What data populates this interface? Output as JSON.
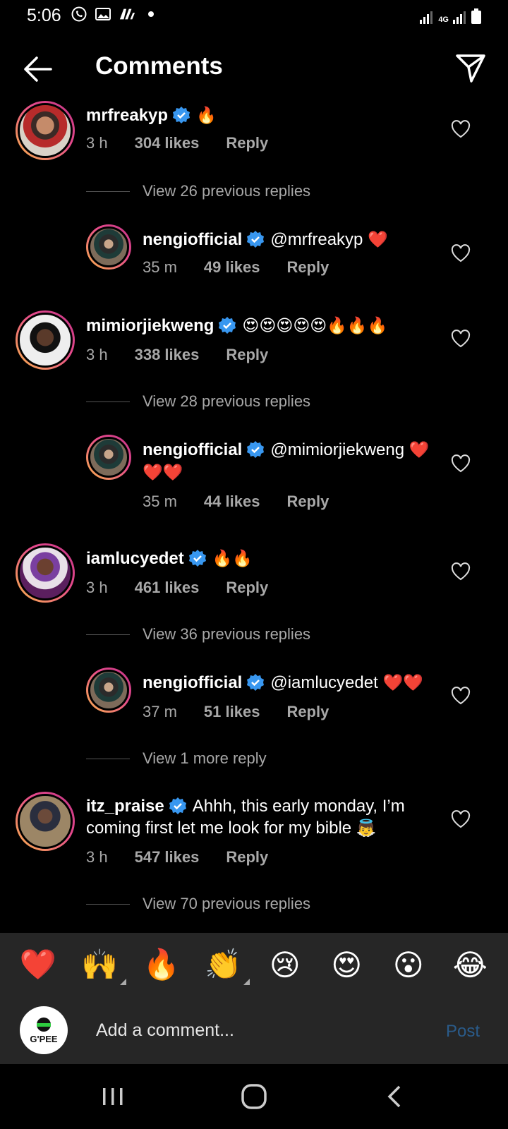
{
  "status_bar": {
    "time": "5:06",
    "network": "4G"
  },
  "header": {
    "title": "Comments"
  },
  "comments": [
    {
      "user": "mrfreakyp",
      "text": "",
      "emoji": "🔥",
      "time": "3 h",
      "likes": "304 likes",
      "reply": "Reply",
      "view_replies": "View 26 previous replies",
      "sub": {
        "user": "nengiofficial",
        "text": "@mrfreakyp",
        "emoji": "❤️",
        "time": "35 m",
        "likes": "49 likes",
        "reply": "Reply"
      }
    },
    {
      "user": "mimiorjiekweng",
      "text": "",
      "emoji": "😍😍😍😍😍🔥🔥🔥",
      "time": "3 h",
      "likes": "338 likes",
      "reply": "Reply",
      "view_replies": "View 28 previous replies",
      "sub": {
        "user": "nengiofficial",
        "text": "@mimiorjiekweng",
        "emoji": "❤️",
        "emoji2": "❤️❤️",
        "time": "35 m",
        "likes": "44 likes",
        "reply": "Reply"
      }
    },
    {
      "user": "iamlucyedet",
      "text": "",
      "emoji": "🔥🔥",
      "time": "3 h",
      "likes": "461 likes",
      "reply": "Reply",
      "view_replies": "View 36 previous replies",
      "sub": {
        "user": "nengiofficial",
        "text": "@iamlucyedet",
        "emoji": "❤️❤️",
        "time": "37 m",
        "likes": "51 likes",
        "reply": "Reply"
      },
      "more_replies": "View 1 more reply"
    },
    {
      "user": "itz_praise",
      "text": "Ahhh, this early monday, I’m",
      "text2": "coming first let me look for my bible",
      "emoji": "👼",
      "time": "3 h",
      "likes": "547 likes",
      "reply": "Reply",
      "view_replies": "View 70 previous replies"
    }
  ],
  "emoji_bar": [
    "❤️",
    "🙌",
    "🔥",
    "👏",
    "😢",
    "😍",
    "😮",
    "😂"
  ],
  "comment_input": {
    "placeholder": "Add a comment...",
    "post_label": "Post",
    "avatar_text": "G'PEE"
  },
  "colors": {
    "background": "#000000",
    "secondary_text": "#a8a8a8",
    "verified": "#3897f0",
    "post_disabled": "#2a5b8a",
    "bar_bg": "#262626"
  }
}
